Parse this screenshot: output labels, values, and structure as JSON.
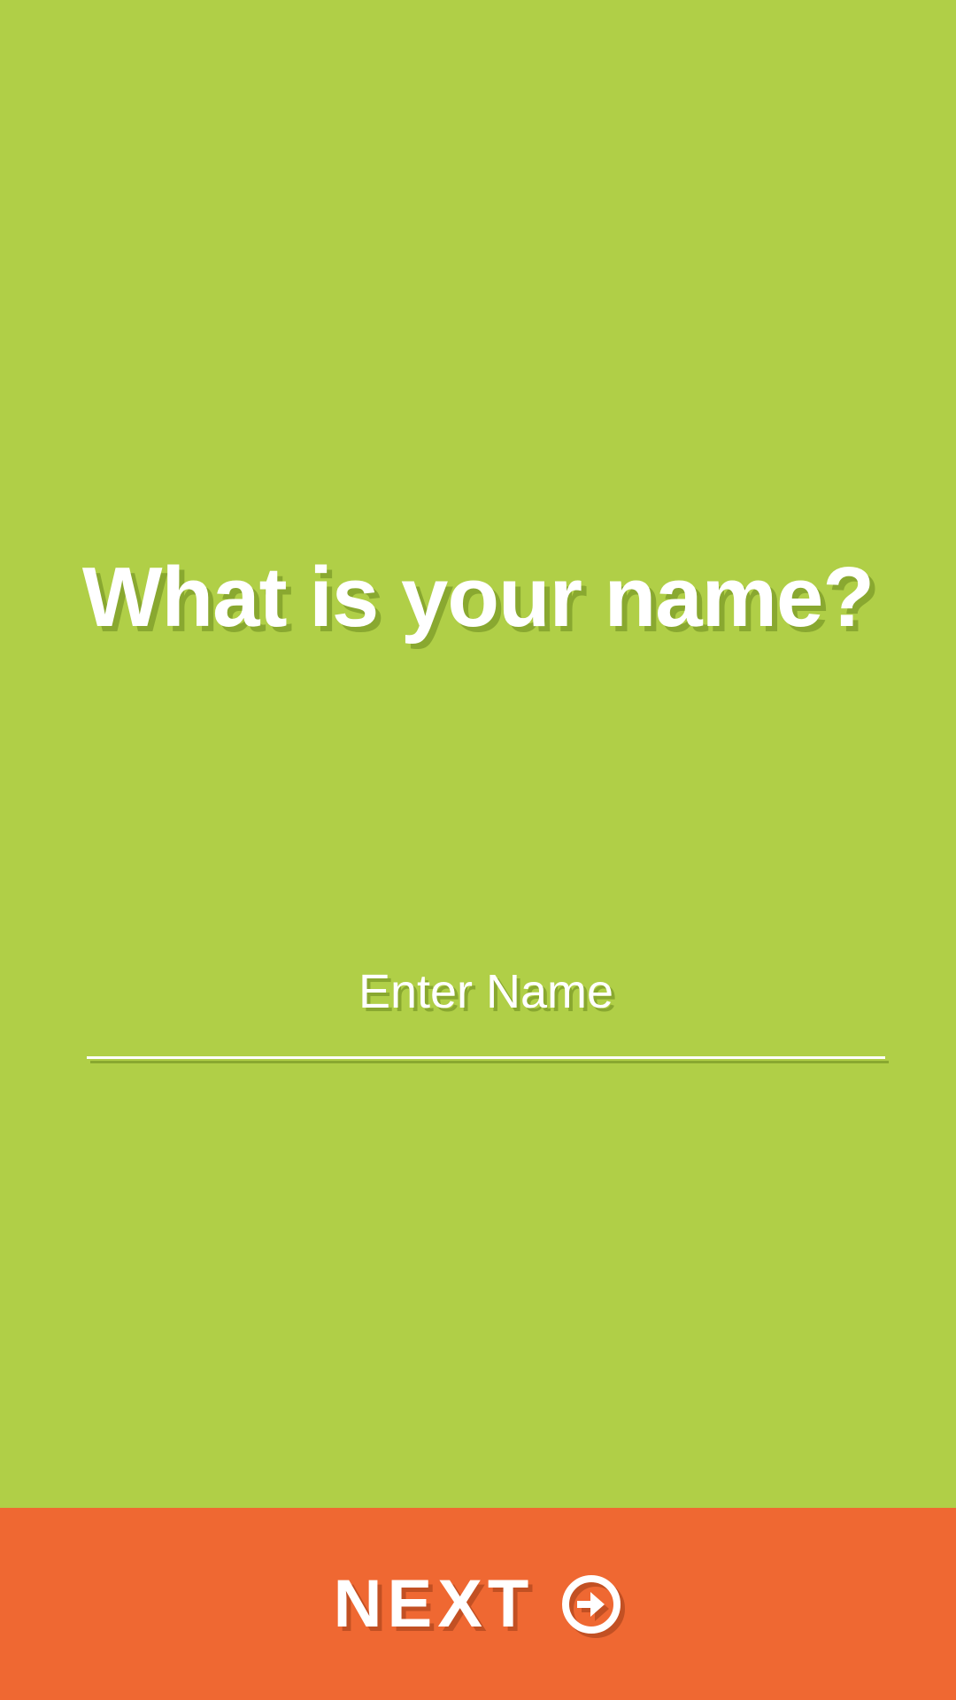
{
  "colors": {
    "background": "#b0cf47",
    "next_bar": "#ef6832",
    "text": "#ffffff"
  },
  "question": {
    "title": "What is your name?"
  },
  "name_field": {
    "value": "",
    "placeholder": "Enter Name"
  },
  "next_button": {
    "label": "NEXT",
    "icon": "arrow-right-circle-icon"
  }
}
